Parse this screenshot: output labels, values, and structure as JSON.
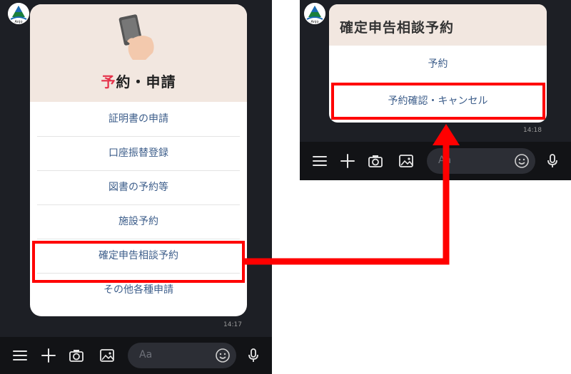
{
  "left": {
    "hero_title_accent": "予",
    "hero_title_rest": "約・申請",
    "menu": [
      {
        "label": "証明書の申請"
      },
      {
        "label": "口座振替登録"
      },
      {
        "label": "図書の予約等"
      },
      {
        "label": "施設予約"
      },
      {
        "label": "確定申告相談予約"
      },
      {
        "label": "その他各種申請"
      }
    ],
    "timestamp": "14:17",
    "input_placeholder": "Aa"
  },
  "right": {
    "header": "確定申告相談予約",
    "menu": [
      {
        "label": "予約"
      },
      {
        "label": "予約確認・キャンセル"
      }
    ],
    "timestamp": "14:18",
    "input_placeholder": "Aa"
  },
  "avatar_label": "Anjo",
  "colors": {
    "accent": "#e5334b",
    "link": "#3c5d8a",
    "highlight": "#ff0000",
    "chat_bg": "#1d1f25",
    "hero_bg": "#f2e7e0"
  },
  "icons": [
    "menu-icon",
    "plus-icon",
    "camera-icon",
    "image-icon",
    "emoji-icon",
    "mic-icon",
    "phone-hand-icon"
  ]
}
